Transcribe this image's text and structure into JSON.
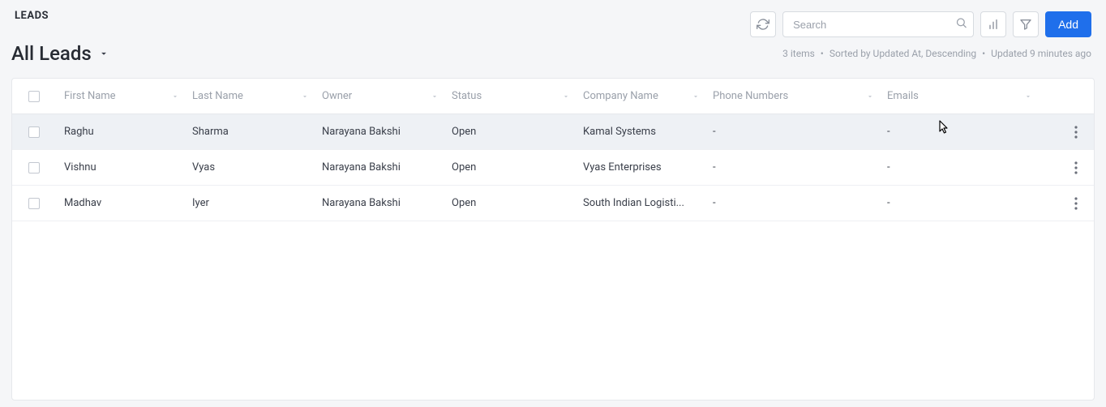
{
  "page": {
    "title": "LEADS",
    "view_label": "All Leads",
    "add_button": "Add"
  },
  "search": {
    "placeholder": "Search"
  },
  "status": {
    "items": "3 items",
    "sorted": "Sorted by Updated At, Descending",
    "updated": "Updated 9 minutes ago"
  },
  "columns": {
    "firstname": "First Name",
    "lastname": "Last Name",
    "owner": "Owner",
    "status": "Status",
    "company": "Company Name",
    "phone": "Phone Numbers",
    "emails": "Emails"
  },
  "rows": [
    {
      "firstname": "Raghu",
      "lastname": "Sharma",
      "owner": "Narayana Bakshi",
      "status": "Open",
      "company": "Kamal Systems",
      "phone": "-",
      "emails": "-"
    },
    {
      "firstname": "Vishnu",
      "lastname": "Vyas",
      "owner": "Narayana Bakshi",
      "status": "Open",
      "company": "Vyas Enterprises",
      "phone": "-",
      "emails": "-"
    },
    {
      "firstname": "Madhav",
      "lastname": "Iyer",
      "owner": "Narayana Bakshi",
      "status": "Open",
      "company": "South Indian Logisti...",
      "phone": "-",
      "emails": "-"
    }
  ]
}
